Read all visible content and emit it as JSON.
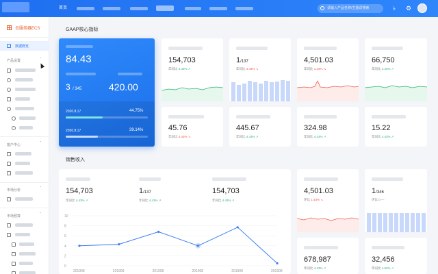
{
  "topbar": {
    "nav_home": "首页",
    "search_placeholder": "请输入产品名称/主题词搜索",
    "icons": [
      "bell-icon",
      "gear-icon"
    ]
  },
  "sidebar": {
    "product": "云服务器ECS",
    "selected_item": "数据概览",
    "groups": [
      "产品设置",
      "客户中心",
      "市场分析",
      "市场预算"
    ]
  },
  "kpi_section": {
    "title": "GAAP核心指标",
    "featured": {
      "main_value": "84.43",
      "ratio_value": "3",
      "ratio_total": "/ 345",
      "amount": "420.00",
      "progress": [
        {
          "date": "2020.8.17",
          "percent_label": "44.75%",
          "fraction": 0.4475
        },
        {
          "date": "2020.8.17",
          "percent_label": "39.14%",
          "fraction": 0.3914
        }
      ]
    },
    "row1": [
      {
        "value": "154,703",
        "suffix": "",
        "meta_label": "年同比",
        "meta_value": "4.43%",
        "trend": "up"
      },
      {
        "value": "1",
        "suffix": "/137",
        "meta_label": "年同比",
        "meta_value": "4.43%",
        "trend": "down"
      },
      {
        "value": "4,501.03",
        "suffix": "",
        "meta_label": "年同比",
        "meta_value": "1.43%",
        "trend": "down"
      },
      {
        "value": "66,750",
        "suffix": "",
        "meta_label": "年同比",
        "meta_value": "4.43%",
        "trend": "up"
      }
    ],
    "row2": [
      {
        "value": "45.76",
        "meta_label": "年同比",
        "meta_value": "4.43%",
        "trend": "down"
      },
      {
        "value": "445.67",
        "meta_label": "年同比",
        "meta_value": "4.43%",
        "trend": "up"
      },
      {
        "value": "324.98",
        "meta_label": "年同比",
        "meta_value": "4.43%",
        "trend": "up"
      },
      {
        "value": "15.22",
        "meta_label": "年同比",
        "meta_value": "4.43%",
        "trend": "up"
      }
    ]
  },
  "sales_section": {
    "title": "销售收入",
    "stats": [
      {
        "value": "154,703",
        "suffix": "",
        "meta_label": "年同比",
        "meta_value": "4.43%",
        "trend": "up"
      },
      {
        "value": "1",
        "suffix": "/137",
        "meta_label": "年同比",
        "meta_value": "4.43%",
        "trend": "up"
      },
      {
        "value": "154,703",
        "suffix": "",
        "meta_label": "年同比",
        "meta_value": "4.43%",
        "trend": "up"
      }
    ],
    "side_cards": [
      {
        "value": "4,501.03",
        "suffix": "",
        "meta_label": "环比",
        "meta_value": "1.43%",
        "trend": "down"
      },
      {
        "value": "1",
        "suffix": "/346",
        "meta_label": "环比",
        "meta_value": "0",
        "trend": "flat"
      },
      {
        "value": "678,987",
        "suffix": "",
        "meta_label": "年同比",
        "meta_value": "4.43%",
        "trend": "up"
      },
      {
        "value": "32,456",
        "suffix": "",
        "meta_label": "年同比",
        "meta_value": "4.62%",
        "trend": "up"
      }
    ]
  },
  "colors": {
    "brand": "#1f6ff0",
    "up": "#2bb673",
    "down": "#f05a4a",
    "line": "#3d7ef0"
  },
  "chart_data": {
    "type": "line",
    "categories": [
      "201908",
      "201908",
      "201908",
      "201908",
      "201908",
      "201908"
    ],
    "values": [
      4,
      4.3,
      6.8,
      4,
      7.7,
      0.5
    ],
    "ylim": [
      0,
      10
    ],
    "yticks": [
      0,
      2,
      4,
      6,
      8,
      10
    ],
    "highlight_index": 3
  }
}
